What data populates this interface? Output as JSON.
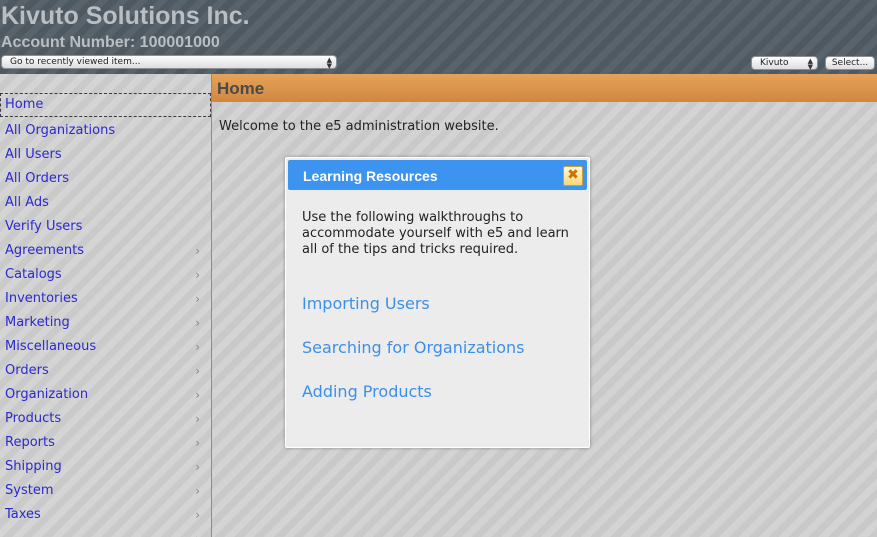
{
  "header": {
    "company_name": "Kivuto Solutions Inc.",
    "account_number": "Account Number: 100001000",
    "recent_select": "Go to recently viewed item...",
    "tenant_select": "Kivuto",
    "select_button": "Select..."
  },
  "sidebar": {
    "items": [
      {
        "label": "Home",
        "has_submenu": false
      },
      {
        "label": "All Organizations",
        "has_submenu": false
      },
      {
        "label": "All Users",
        "has_submenu": false
      },
      {
        "label": "All Orders",
        "has_submenu": false
      },
      {
        "label": "All Ads",
        "has_submenu": false
      },
      {
        "label": "Verify Users",
        "has_submenu": false
      },
      {
        "label": "Agreements",
        "has_submenu": true
      },
      {
        "label": "Catalogs",
        "has_submenu": true
      },
      {
        "label": "Inventories",
        "has_submenu": true
      },
      {
        "label": "Marketing",
        "has_submenu": true
      },
      {
        "label": "Miscellaneous",
        "has_submenu": true
      },
      {
        "label": "Orders",
        "has_submenu": true
      },
      {
        "label": "Organization",
        "has_submenu": true
      },
      {
        "label": "Products",
        "has_submenu": true
      },
      {
        "label": "Reports",
        "has_submenu": true
      },
      {
        "label": "Shipping",
        "has_submenu": true
      },
      {
        "label": "System",
        "has_submenu": true
      },
      {
        "label": "Taxes",
        "has_submenu": true
      }
    ],
    "chevron": "›"
  },
  "main": {
    "page_title": "Home",
    "welcome_text": "Welcome to the e5 administration website."
  },
  "modal": {
    "title": "Learning Resources",
    "close_glyph": "✖",
    "description": "Use the following walkthroughs to accommodate yourself with e5 and learn all of the tips and tricks required.",
    "links": [
      "Importing Users",
      "Searching for Organizations",
      "Adding Products"
    ]
  },
  "colors": {
    "header_bg": "#4f5962",
    "nav_link": "#2a2ad0",
    "page_bar": "#d98f45",
    "modal_header": "#3d94f0",
    "modal_link": "#3d8fe8"
  }
}
